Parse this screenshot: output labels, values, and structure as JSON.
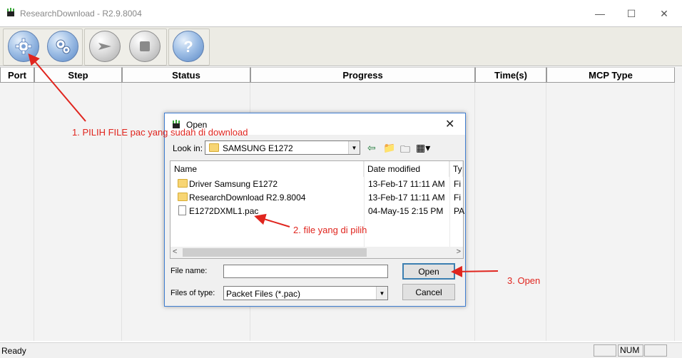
{
  "window": {
    "title": "ResearchDownload - R2.9.8004"
  },
  "toolbar": {
    "buttons": [
      {
        "icon": "gear-icon"
      },
      {
        "icon": "gears-icon"
      },
      {
        "icon": "play-icon"
      },
      {
        "icon": "stop-icon"
      },
      {
        "icon": "help-icon"
      }
    ]
  },
  "grid": {
    "columns": [
      "Port",
      "Step",
      "Status",
      "Progress",
      "Time(s)",
      "MCP Type"
    ]
  },
  "statusbar": {
    "status": "Ready",
    "num": "NUM"
  },
  "dialog": {
    "title": "Open",
    "look_in_label": "Look in:",
    "look_in_value": "SAMSUNG E1272",
    "columns": {
      "name": "Name",
      "date": "Date modified",
      "type": "Ty"
    },
    "files": [
      {
        "name": "Driver Samsung E1272",
        "date": "13-Feb-17 11:11 AM",
        "type": "Fi",
        "kind": "folder"
      },
      {
        "name": "ResearchDownload R2.9.8004",
        "date": "13-Feb-17 11:11 AM",
        "type": "Fi",
        "kind": "folder"
      },
      {
        "name": "E1272DXML1.pac",
        "date": "04-May-15 2:15 PM",
        "type": "PA",
        "kind": "file"
      }
    ],
    "file_name_label": "File name:",
    "file_name_value": "",
    "files_of_type_label": "Files of type:",
    "files_of_type_value": "Packet Files (*.pac)",
    "open_label": "Open",
    "cancel_label": "Cancel"
  },
  "annotations": {
    "step1": "1. PILIH FILE pac yang sudah di download",
    "step2": "2. file yang di pilih",
    "step3": "3. Open"
  },
  "colors": {
    "annotation": "#e0251e",
    "dialog_border": "#3f7ed2",
    "toolbar_button": "#5c89c6"
  }
}
